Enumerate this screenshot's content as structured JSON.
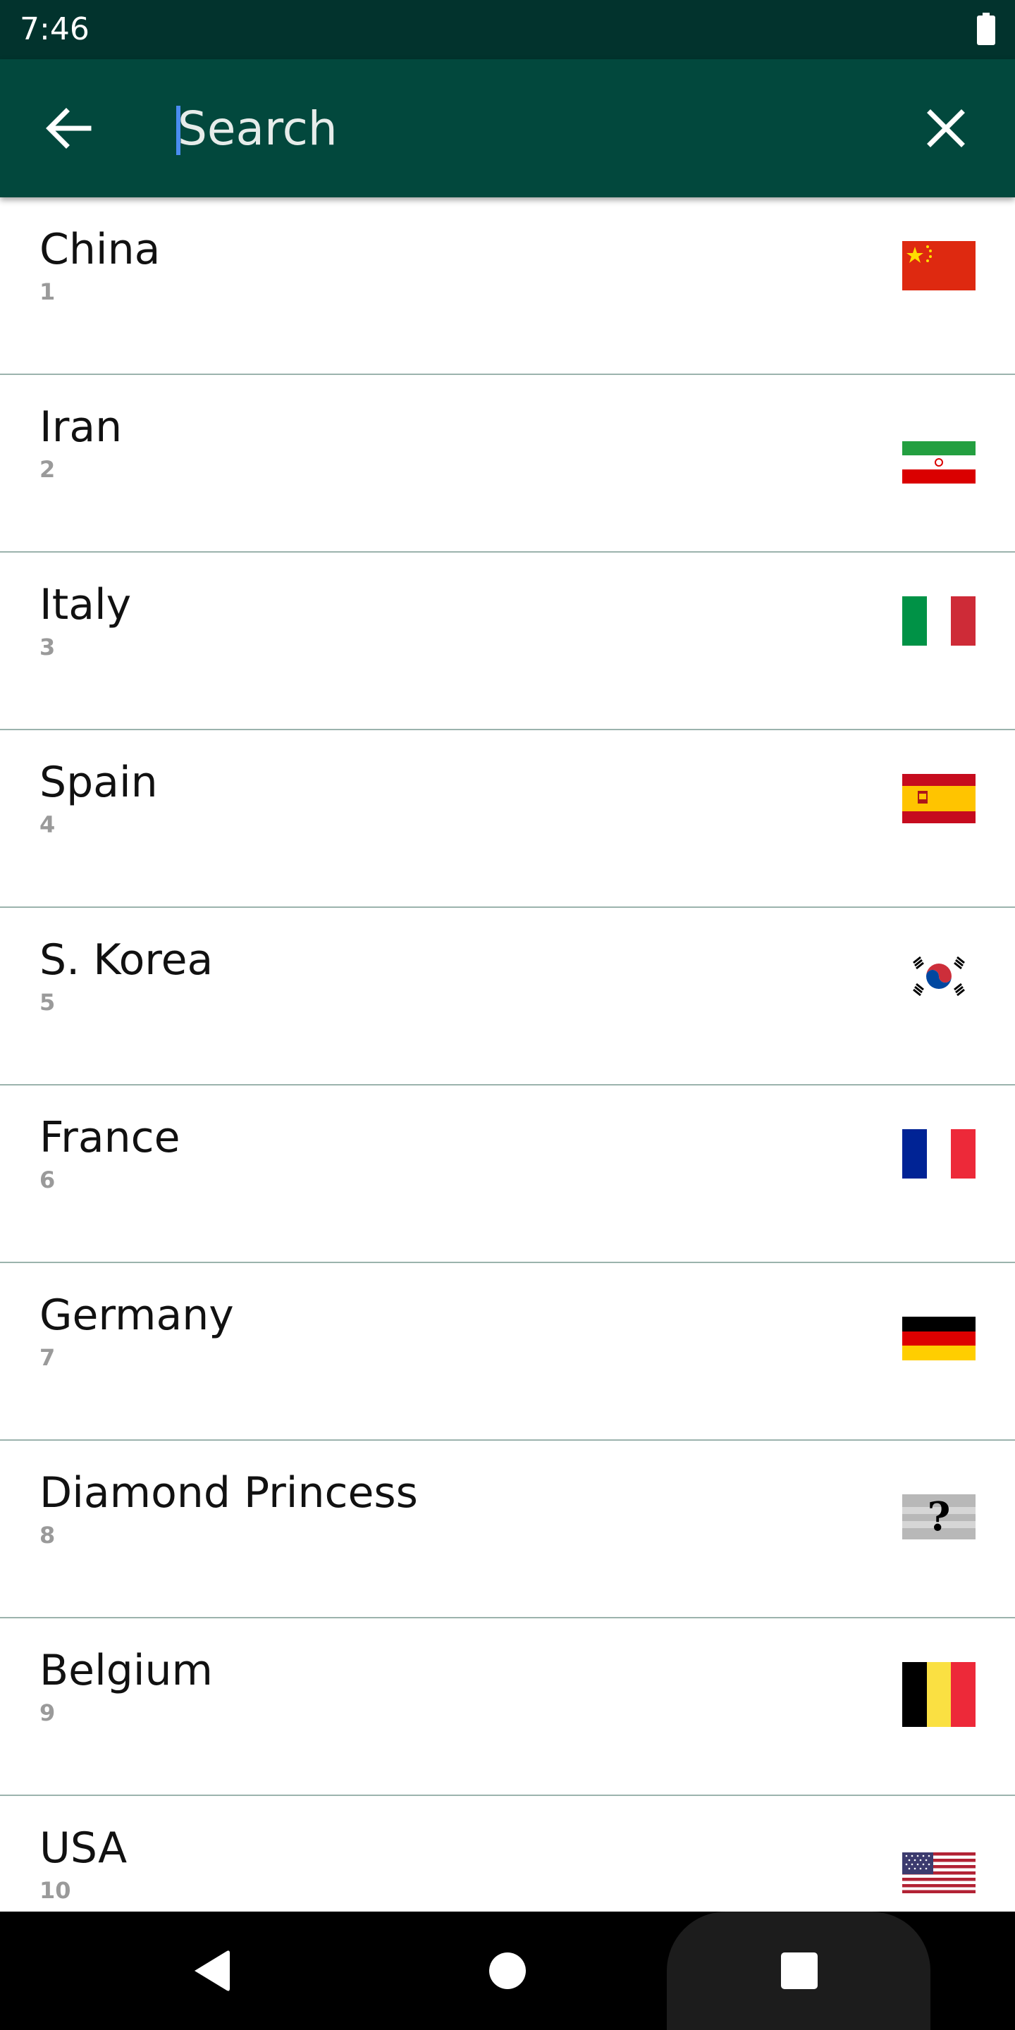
{
  "status_bar": {
    "time": "7:46"
  },
  "search": {
    "placeholder": "Search",
    "value": ""
  },
  "countries": [
    {
      "name": "China",
      "rank": "1",
      "flag": "china"
    },
    {
      "name": "Iran",
      "rank": "2",
      "flag": "iran"
    },
    {
      "name": "Italy",
      "rank": "3",
      "flag": "italy"
    },
    {
      "name": "Spain",
      "rank": "4",
      "flag": "spain"
    },
    {
      "name": "S. Korea",
      "rank": "5",
      "flag": "south-korea"
    },
    {
      "name": "France",
      "rank": "6",
      "flag": "france"
    },
    {
      "name": "Germany",
      "rank": "7",
      "flag": "germany"
    },
    {
      "name": "Diamond Princess",
      "rank": "8",
      "flag": "unknown",
      "flag_symbol": "?"
    },
    {
      "name": "Belgium",
      "rank": "9",
      "flag": "belgium"
    },
    {
      "name": "USA",
      "rank": "10",
      "flag": "usa"
    }
  ],
  "colors": {
    "status_bar": "#02332d",
    "app_bar": "#02483d",
    "divider": "#9bb3ad",
    "cursor": "#4a8cf0"
  },
  "icons": {
    "back": "arrow-left-icon",
    "clear": "close-icon",
    "battery": "battery-icon",
    "nav_back": "triangle-back-icon",
    "nav_home": "circle-home-icon",
    "nav_recents": "square-recents-icon"
  }
}
